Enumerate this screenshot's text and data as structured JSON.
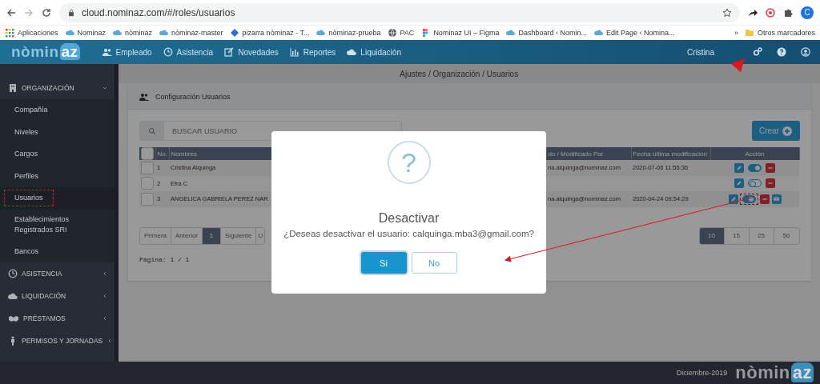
{
  "browser": {
    "url": "cloud.nominaz.com/#/roles/usuarios",
    "profile_initial": "C",
    "bookmarks": [
      {
        "label": "Aplicaciones",
        "kind": "apps"
      },
      {
        "label": "Nominaz",
        "kind": "cloud"
      },
      {
        "label": "nòminaz",
        "kind": "cloud"
      },
      {
        "label": "nòminaz-master",
        "kind": "cloud"
      },
      {
        "label": "pizarra nòminaz - T...",
        "kind": "diamond"
      },
      {
        "label": "nòminaz-prueba",
        "kind": "cloud"
      },
      {
        "label": "PAC",
        "kind": "globe"
      },
      {
        "label": "Nominaz UI – Figma",
        "kind": "figma"
      },
      {
        "label": "Dashboard ‹ Nomin...",
        "kind": "cloud"
      },
      {
        "label": "Edit Page ‹ Nomina...",
        "kind": "cloud"
      }
    ],
    "overflow": "»",
    "other_bookmarks": "Otros marcadores"
  },
  "header": {
    "logo": {
      "main": "nòmin",
      "accent": "az"
    },
    "nav": [
      {
        "label": "Empleado",
        "kind": "users"
      },
      {
        "label": "Asistencia",
        "kind": "clock"
      },
      {
        "label": "Novedades",
        "kind": "edit"
      },
      {
        "label": "Reportes",
        "kind": "chart"
      },
      {
        "label": "Liquidación",
        "kind": "cloud"
      }
    ],
    "user": "Cristina"
  },
  "sidebar": {
    "groups": [
      {
        "label": "ORGANIZACIÓN",
        "kind": "building",
        "expanded": true,
        "children": [
          {
            "label": "Compañía",
            "selected": false,
            "highlighted": false
          },
          {
            "label": "Niveles",
            "selected": false,
            "highlighted": false
          },
          {
            "label": "Cargos",
            "selected": false,
            "highlighted": false
          },
          {
            "label": "Perfiles",
            "selected": false,
            "highlighted": false
          },
          {
            "label": "Usuarios",
            "selected": true,
            "highlighted": true
          },
          {
            "label": "Establecimientos Registrados SRI",
            "selected": false,
            "highlighted": false
          },
          {
            "label": "Bancos",
            "selected": false,
            "highlighted": false
          }
        ]
      },
      {
        "label": "ASISTENCIA",
        "kind": "clock",
        "expanded": false
      },
      {
        "label": "LIQUIDACIÓN",
        "kind": "cloud",
        "expanded": false
      },
      {
        "label": "PRÉSTAMOS",
        "kind": "handshake",
        "expanded": false
      },
      {
        "label": "PERMISOS Y JORNADAS",
        "kind": "person",
        "expanded": false
      }
    ]
  },
  "main": {
    "breadcrumb": "Ajustes / Organización / Usuarios",
    "card_title": "Configuración Usuarios",
    "search": {
      "placeholder": "BUSCAR USUARIO"
    },
    "create_button": "Crear",
    "table": {
      "select_all_checked": false,
      "columns": [
        "No.",
        "Nombres",
        "do / Modificado Por",
        "Fecha última modificación",
        "Acción"
      ],
      "rows": [
        {
          "checked": false,
          "no": "1",
          "name": "Cristina Alquinga",
          "modified_by": "na.alquinga@nominaz.com",
          "date": "2020-07-06 11:55:36",
          "active": true,
          "highlighted": false,
          "mail": false
        },
        {
          "checked": false,
          "no": "2",
          "name": "Efra C",
          "active": false,
          "highlighted": false,
          "mail": false
        },
        {
          "checked": false,
          "no": "3",
          "name": "ANGELICA GABRIELA PEREZ NAR",
          "modified_by": "na.alquinga@nominaz.com",
          "date": "2020-04-24 09:54:29",
          "active": true,
          "highlighted": true,
          "mail": true
        }
      ]
    },
    "pagination": {
      "pages": [
        {
          "label": "Primera",
          "selected": false
        },
        {
          "label": "Anterior",
          "selected": false
        },
        {
          "label": "1",
          "selected": true
        },
        {
          "label": "Siguiente",
          "selected": false
        },
        {
          "label": "U",
          "selected": false
        }
      ],
      "page_info": "Página: 1 / 1",
      "page_sizes": [
        {
          "label": "10",
          "selected": true
        },
        {
          "label": "15",
          "selected": false
        },
        {
          "label": "25",
          "selected": false
        },
        {
          "label": "50",
          "selected": false
        }
      ]
    }
  },
  "dialog": {
    "icon_glyph": "?",
    "title": "Desactivar",
    "message": "¿Deseas desactivar el usuario: calquinga.mba3@gmail.com?",
    "buttons": [
      {
        "label": "Si",
        "kind": "primary"
      },
      {
        "label": "No",
        "kind": "secondary"
      }
    ]
  },
  "footer": {
    "date": "Diciembre-2019",
    "logo": {
      "main": "nòmin",
      "accent": "az"
    }
  }
}
